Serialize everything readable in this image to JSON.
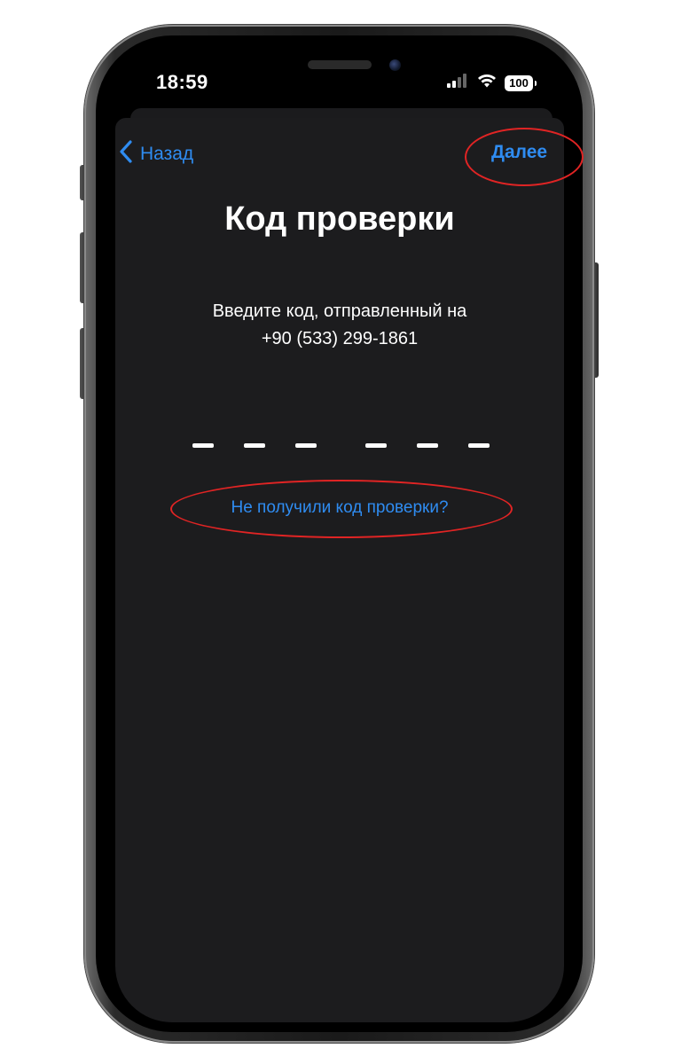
{
  "status_bar": {
    "time": "18:59",
    "battery": "100",
    "icons": [
      "signal-icon",
      "wifi-icon",
      "battery-icon"
    ]
  },
  "nav": {
    "back_label": "Назад",
    "back_icon": "chevron-left-icon",
    "next_label": "Далее"
  },
  "page": {
    "title": "Код проверки",
    "subtitle_line1": "Введите код, отправленный на",
    "subtitle_line2": "+90 (533) 299-1861"
  },
  "code_input": {
    "length": 6,
    "value": ""
  },
  "resend_link": "Не получили код проверки?",
  "colors": {
    "accent": "#2f8cf1",
    "background": "#1c1c1e",
    "annotation": "#e02424"
  }
}
